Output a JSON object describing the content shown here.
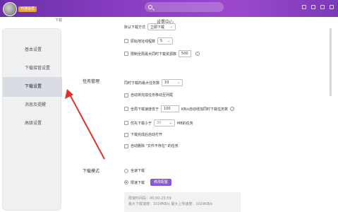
{
  "header": {
    "vip_badge": "开通会员",
    "breadcrumb": "下载",
    "dialog_title": "设置中心"
  },
  "sidebar": {
    "items": [
      {
        "label": "基本设置"
      },
      {
        "label": "下载接管设置"
      },
      {
        "label": "下载设置"
      },
      {
        "label": "消息及提醒"
      },
      {
        "label": "高级设置"
      }
    ],
    "active_index": 2
  },
  "top_rows": {
    "mode_label": "默认下载方式",
    "mode_value": "立即下载",
    "proxy_label": "原始地址线程数",
    "proxy_value": "5",
    "limit_label": "限制全局最大同时下载资源数",
    "limit_value": "500"
  },
  "task_mgmt": {
    "section_label": "任务管理",
    "max_tasks_label": "同时下载的最大任务数",
    "max_tasks_value": "33",
    "auto_move_label": "自动将完成任务移动至列尾",
    "speed_label_pre": "全局下载速度低于",
    "speed_value": "100",
    "speed_label_post": "KB/s自动增加同时下载任务数",
    "priority_label_pre": "优先下载小于",
    "priority_value": "30",
    "priority_label_post": "MB的任务",
    "open_after_label": "下载完成后自动打开",
    "delete_missing_label": "自动删除 \"文件不存在\" 的任务"
  },
  "download_mode": {
    "section_label": "下载模式",
    "full_speed_label": "全速下载",
    "limited_label": "限速下载",
    "modify_button": "修改配置",
    "box_line1": "限速时间段：00:00-23:59",
    "box_line2": "最大下载速度：1024KB/s    最大上传速度：1024KB/s"
  }
}
